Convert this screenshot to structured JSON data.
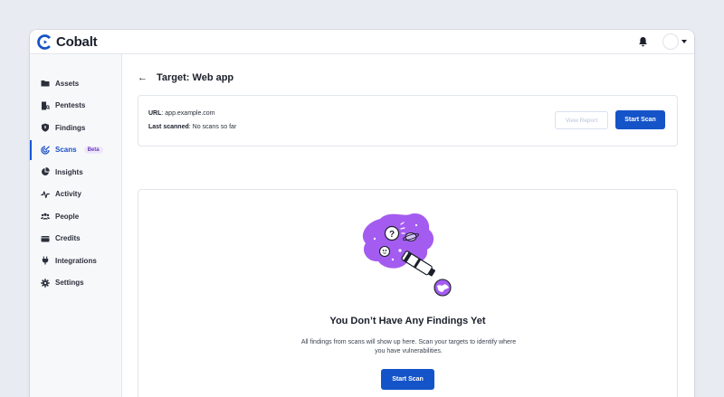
{
  "app": {
    "logo_text": "Cobalt"
  },
  "colors": {
    "accent": "#1554c8",
    "active_nav": "#1a4fc9",
    "badge_bg": "#efe6fb",
    "badge_text": "#6a3fb8",
    "illustration": "#a45cf0"
  },
  "header": {
    "icons": [
      "bell-icon",
      "avatar",
      "chevron-down-icon"
    ]
  },
  "sidebar": {
    "items": [
      {
        "label": "Assets",
        "icon": "folder-icon"
      },
      {
        "label": "Pentests",
        "icon": "pentest-doc-icon"
      },
      {
        "label": "Findings",
        "icon": "shield-icon"
      },
      {
        "label": "Scans",
        "icon": "scan-radar-icon",
        "badge": "Beta",
        "active": true
      },
      {
        "label": "Insights",
        "icon": "pie-chart-icon"
      },
      {
        "label": "Activity",
        "icon": "pulse-icon"
      },
      {
        "label": "People",
        "icon": "people-icon"
      },
      {
        "label": "Credits",
        "icon": "wallet-icon"
      },
      {
        "label": "Integrations",
        "icon": "plug-icon"
      },
      {
        "label": "Settings",
        "icon": "gear-icon"
      }
    ]
  },
  "page": {
    "back_icon": "arrow-left-icon",
    "title": "Target: Web app"
  },
  "target": {
    "url_label": "URL",
    "url_value": ": app.example.com",
    "last_scanned_label": "Last scanned",
    "last_scanned_value": ": No scans so far",
    "view_report_label": "View Report",
    "start_scan_label": "Start Scan"
  },
  "empty_state": {
    "illustration": "telescope-planets-illustration",
    "title": "You Don’t Have Any Findings Yet",
    "description": "All findings from scans will show up here. Scan your targets to identify where you have vulnerabilities.",
    "cta_label": "Start Scan"
  }
}
